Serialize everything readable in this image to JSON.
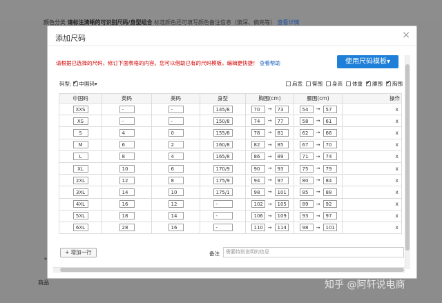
{
  "background": {
    "top_text_bold": "请标注清晰的可识别尺码/身型组合",
    "top_text_prefix": "颜色分类",
    "top_text_gray": "标准颜色还可填写颜色备注信息（偏深、偏亮等）",
    "top_text_link": "查看详情",
    "left_label": "商品",
    "left_dot": "*"
  },
  "modal": {
    "title": "添加尺码",
    "close_glyph": "×",
    "notice": "请根据已选择的尺码，修订下面表格的内容。您可以借助已有的尺码模板，编辑更快捷！",
    "help_link": "查看帮助",
    "template_button": "使用尺码模板▾",
    "size_type_label": "码型:",
    "size_type_value": "中国码▾",
    "options": [
      {
        "label": "肩宽",
        "checked": false
      },
      {
        "label": "臀围",
        "checked": false
      },
      {
        "label": "身高",
        "checked": false
      },
      {
        "label": "体重",
        "checked": false
      },
      {
        "label": "腰围",
        "checked": true
      },
      {
        "label": "胸围",
        "checked": true
      }
    ],
    "columns": [
      "中国码",
      "英码",
      "美码",
      "身型",
      "胸围(cm)",
      "腰围(cm)",
      "操作"
    ],
    "rows": [
      {
        "cn": "XXS",
        "uk": "-",
        "us": "-",
        "body": "145/8",
        "chest_from": "70",
        "chest_to": "73",
        "waist_from": "54",
        "waist_to": "57",
        "op": "x"
      },
      {
        "cn": "XS",
        "uk": "-",
        "us": "-",
        "body": "150/8",
        "chest_from": "74",
        "chest_to": "77",
        "waist_from": "58",
        "waist_to": "61",
        "op": "x"
      },
      {
        "cn": "S",
        "uk": "4",
        "us": "0",
        "body": "155/8",
        "chest_from": "78",
        "chest_to": "81",
        "waist_from": "62",
        "waist_to": "66",
        "op": "x"
      },
      {
        "cn": "M",
        "uk": "6",
        "us": "2",
        "body": "160/8",
        "chest_from": "82",
        "chest_to": "85",
        "waist_from": "67",
        "waist_to": "70",
        "op": "x"
      },
      {
        "cn": "L",
        "uk": "8",
        "us": "4",
        "body": "165/8",
        "chest_from": "86",
        "chest_to": "89",
        "waist_from": "71",
        "waist_to": "74",
        "op": "x"
      },
      {
        "cn": "XL",
        "uk": "10",
        "us": "6",
        "body": "170/9",
        "chest_from": "90",
        "chest_to": "93",
        "waist_from": "75",
        "waist_to": "79",
        "op": "x"
      },
      {
        "cn": "2XL",
        "uk": "12",
        "us": "8",
        "body": "175/9",
        "chest_from": "94",
        "chest_to": "97",
        "waist_from": "80",
        "waist_to": "84",
        "op": "x"
      },
      {
        "cn": "3XL",
        "uk": "14",
        "us": "10",
        "body": "175/1",
        "chest_from": "98",
        "chest_to": "101",
        "waist_from": "85",
        "waist_to": "88",
        "op": "x"
      },
      {
        "cn": "4XL",
        "uk": "16",
        "us": "12",
        "body": "-",
        "chest_from": "102",
        "chest_to": "105",
        "waist_from": "89",
        "waist_to": "92",
        "op": "x"
      },
      {
        "cn": "5XL",
        "uk": "18",
        "us": "14",
        "body": "-",
        "chest_from": "106",
        "chest_to": "109",
        "waist_from": "93",
        "waist_to": "97",
        "op": "x"
      },
      {
        "cn": "6XL",
        "uk": "28",
        "us": "16",
        "body": "-",
        "chest_from": "110",
        "chest_to": "114",
        "waist_from": "98",
        "waist_to": "101",
        "op": "x"
      }
    ],
    "range_arrow": "→",
    "add_row_button": "+ 增加一行",
    "note_label": "备注",
    "note_placeholder": "需要特别说明的信息"
  },
  "watermark": "知乎 @阿轩说电商"
}
